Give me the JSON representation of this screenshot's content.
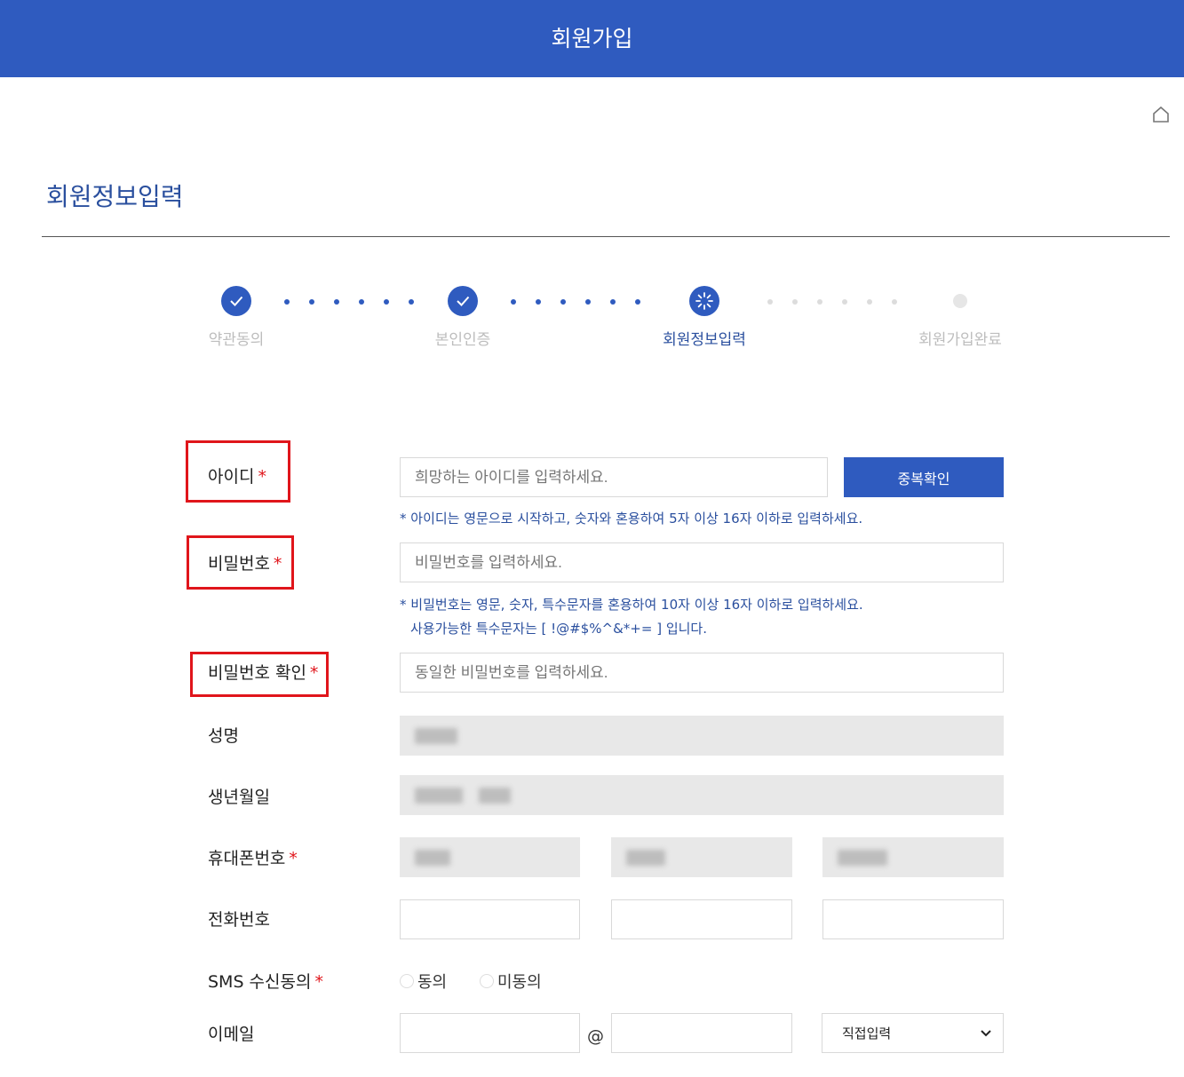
{
  "header": {
    "title": "회원가입"
  },
  "home": {
    "icon": "home-icon"
  },
  "page": {
    "title": "회원정보입력"
  },
  "steps": [
    {
      "label": "약관동의",
      "state": "done",
      "icon": "check-icon"
    },
    {
      "label": "본인인증",
      "state": "done",
      "icon": "check-icon"
    },
    {
      "label": "회원정보입력",
      "state": "active",
      "icon": "loading-icon"
    },
    {
      "label": "회원가입완료",
      "state": "pending",
      "icon": "dot-icon"
    }
  ],
  "form": {
    "id": {
      "label": "아이디",
      "required": "*",
      "placeholder": "희망하는 아이디를 입력하세요.",
      "button": "중복확인",
      "help": "* 아이디는 영문으로 시작하고, 숫자와 혼용하여 5자 이상 16자 이하로 입력하세요."
    },
    "password": {
      "label": "비밀번호",
      "required": "*",
      "placeholder": "비밀번호를 입력하세요.",
      "help1": "* 비밀번호는 영문, 숫자, 특수문자를 혼용하여 10자 이상 16자 이하로 입력하세요.",
      "help2": "사용가능한 특수문자는 [ !@#$%^&*+= ] 입니다."
    },
    "password_confirm": {
      "label": "비밀번호 확인",
      "required": "*",
      "placeholder": "동일한 비밀번호를 입력하세요."
    },
    "name": {
      "label": "성명"
    },
    "birth": {
      "label": "생년월일"
    },
    "mobile": {
      "label": "휴대폰번호",
      "required": "*"
    },
    "phone": {
      "label": "전화번호"
    },
    "sms": {
      "label": "SMS 수신동의",
      "required": "*",
      "agree": "동의",
      "disagree": "미동의"
    },
    "email": {
      "label": "이메일",
      "at": "@",
      "domain_select": "직접입력"
    }
  }
}
